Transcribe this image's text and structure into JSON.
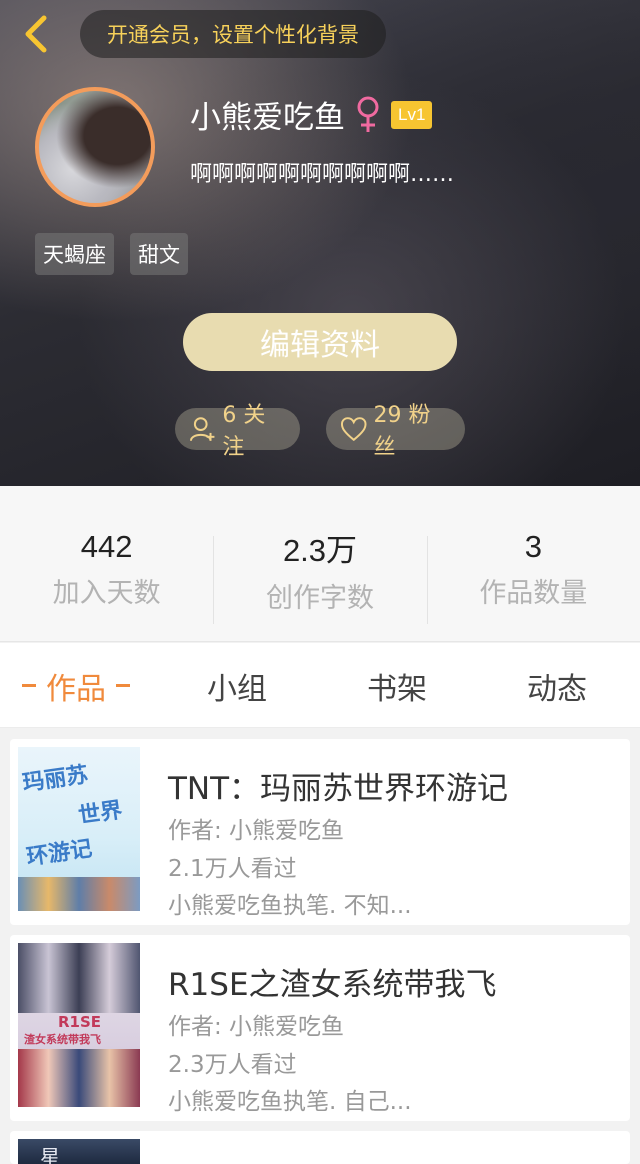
{
  "header": {
    "vip_banner": "开通会员，设置个性化背景",
    "user_name": "小熊爱吃鱼",
    "level": "Lv1",
    "bio": "啊啊啊啊啊啊啊啊啊啊……",
    "tags": [
      "天蝎座",
      "甜文"
    ],
    "edit_button": "编辑资料",
    "follow": "6 关注",
    "fans": "29 粉丝"
  },
  "stats": [
    {
      "value": "442",
      "label": "加入天数"
    },
    {
      "value": "2.3万",
      "label": "创作字数"
    },
    {
      "value": "3",
      "label": "作品数量"
    }
  ],
  "tabs": [
    {
      "label": "作品",
      "active": true
    },
    {
      "label": "小组",
      "active": false
    },
    {
      "label": "书架",
      "active": false
    },
    {
      "label": "动态",
      "active": false
    }
  ],
  "books": [
    {
      "title": "TNT：玛丽苏世界环游记",
      "author": "作者: 小熊爱吃鱼",
      "views": "2.1万人看过",
      "desc": "小熊爱吃鱼执笔. 不知...",
      "cover_text": [
        "玛丽苏",
        "世界",
        "环游记"
      ]
    },
    {
      "title": "R1SE之渣女系统带我飞",
      "author": "作者: 小熊爱吃鱼",
      "views": "2.3万人看过",
      "desc": "小熊爱吃鱼执笔. 自己...",
      "cover_text": [
        "R1SE",
        "渣女系统带我飞"
      ]
    },
    {
      "title": "",
      "cover_text": [
        "星"
      ]
    }
  ],
  "colors": {
    "accent": "#f08a3c",
    "vip_gold": "#f7d15a",
    "level_badge": "#f7c531",
    "edit_button": "#e8dcb0"
  }
}
